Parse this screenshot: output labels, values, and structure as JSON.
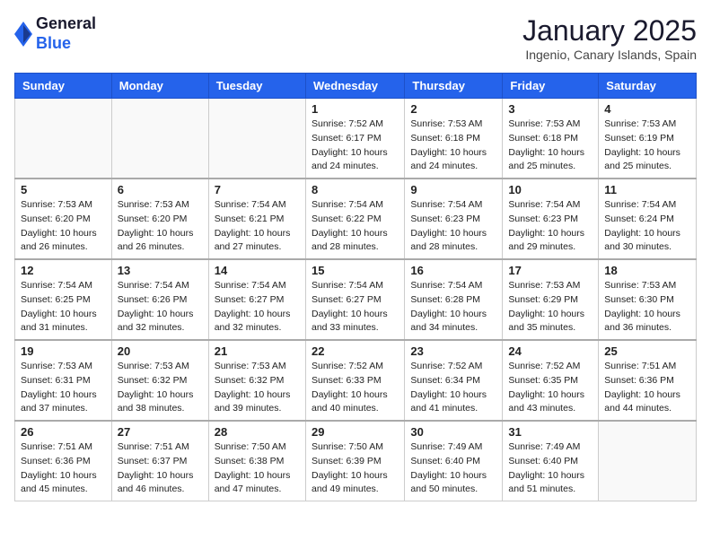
{
  "logo": {
    "general": "General",
    "blue": "Blue"
  },
  "title": "January 2025",
  "location": "Ingenio, Canary Islands, Spain",
  "days_of_week": [
    "Sunday",
    "Monday",
    "Tuesday",
    "Wednesday",
    "Thursday",
    "Friday",
    "Saturday"
  ],
  "weeks": [
    [
      {
        "day": "",
        "detail": ""
      },
      {
        "day": "",
        "detail": ""
      },
      {
        "day": "",
        "detail": ""
      },
      {
        "day": "1",
        "detail": "Sunrise: 7:52 AM\nSunset: 6:17 PM\nDaylight: 10 hours\nand 24 minutes."
      },
      {
        "day": "2",
        "detail": "Sunrise: 7:53 AM\nSunset: 6:18 PM\nDaylight: 10 hours\nand 24 minutes."
      },
      {
        "day": "3",
        "detail": "Sunrise: 7:53 AM\nSunset: 6:18 PM\nDaylight: 10 hours\nand 25 minutes."
      },
      {
        "day": "4",
        "detail": "Sunrise: 7:53 AM\nSunset: 6:19 PM\nDaylight: 10 hours\nand 25 minutes."
      }
    ],
    [
      {
        "day": "5",
        "detail": "Sunrise: 7:53 AM\nSunset: 6:20 PM\nDaylight: 10 hours\nand 26 minutes."
      },
      {
        "day": "6",
        "detail": "Sunrise: 7:53 AM\nSunset: 6:20 PM\nDaylight: 10 hours\nand 26 minutes."
      },
      {
        "day": "7",
        "detail": "Sunrise: 7:54 AM\nSunset: 6:21 PM\nDaylight: 10 hours\nand 27 minutes."
      },
      {
        "day": "8",
        "detail": "Sunrise: 7:54 AM\nSunset: 6:22 PM\nDaylight: 10 hours\nand 28 minutes."
      },
      {
        "day": "9",
        "detail": "Sunrise: 7:54 AM\nSunset: 6:23 PM\nDaylight: 10 hours\nand 28 minutes."
      },
      {
        "day": "10",
        "detail": "Sunrise: 7:54 AM\nSunset: 6:23 PM\nDaylight: 10 hours\nand 29 minutes."
      },
      {
        "day": "11",
        "detail": "Sunrise: 7:54 AM\nSunset: 6:24 PM\nDaylight: 10 hours\nand 30 minutes."
      }
    ],
    [
      {
        "day": "12",
        "detail": "Sunrise: 7:54 AM\nSunset: 6:25 PM\nDaylight: 10 hours\nand 31 minutes."
      },
      {
        "day": "13",
        "detail": "Sunrise: 7:54 AM\nSunset: 6:26 PM\nDaylight: 10 hours\nand 32 minutes."
      },
      {
        "day": "14",
        "detail": "Sunrise: 7:54 AM\nSunset: 6:27 PM\nDaylight: 10 hours\nand 32 minutes."
      },
      {
        "day": "15",
        "detail": "Sunrise: 7:54 AM\nSunset: 6:27 PM\nDaylight: 10 hours\nand 33 minutes."
      },
      {
        "day": "16",
        "detail": "Sunrise: 7:54 AM\nSunset: 6:28 PM\nDaylight: 10 hours\nand 34 minutes."
      },
      {
        "day": "17",
        "detail": "Sunrise: 7:53 AM\nSunset: 6:29 PM\nDaylight: 10 hours\nand 35 minutes."
      },
      {
        "day": "18",
        "detail": "Sunrise: 7:53 AM\nSunset: 6:30 PM\nDaylight: 10 hours\nand 36 minutes."
      }
    ],
    [
      {
        "day": "19",
        "detail": "Sunrise: 7:53 AM\nSunset: 6:31 PM\nDaylight: 10 hours\nand 37 minutes."
      },
      {
        "day": "20",
        "detail": "Sunrise: 7:53 AM\nSunset: 6:32 PM\nDaylight: 10 hours\nand 38 minutes."
      },
      {
        "day": "21",
        "detail": "Sunrise: 7:53 AM\nSunset: 6:32 PM\nDaylight: 10 hours\nand 39 minutes."
      },
      {
        "day": "22",
        "detail": "Sunrise: 7:52 AM\nSunset: 6:33 PM\nDaylight: 10 hours\nand 40 minutes."
      },
      {
        "day": "23",
        "detail": "Sunrise: 7:52 AM\nSunset: 6:34 PM\nDaylight: 10 hours\nand 41 minutes."
      },
      {
        "day": "24",
        "detail": "Sunrise: 7:52 AM\nSunset: 6:35 PM\nDaylight: 10 hours\nand 43 minutes."
      },
      {
        "day": "25",
        "detail": "Sunrise: 7:51 AM\nSunset: 6:36 PM\nDaylight: 10 hours\nand 44 minutes."
      }
    ],
    [
      {
        "day": "26",
        "detail": "Sunrise: 7:51 AM\nSunset: 6:36 PM\nDaylight: 10 hours\nand 45 minutes."
      },
      {
        "day": "27",
        "detail": "Sunrise: 7:51 AM\nSunset: 6:37 PM\nDaylight: 10 hours\nand 46 minutes."
      },
      {
        "day": "28",
        "detail": "Sunrise: 7:50 AM\nSunset: 6:38 PM\nDaylight: 10 hours\nand 47 minutes."
      },
      {
        "day": "29",
        "detail": "Sunrise: 7:50 AM\nSunset: 6:39 PM\nDaylight: 10 hours\nand 49 minutes."
      },
      {
        "day": "30",
        "detail": "Sunrise: 7:49 AM\nSunset: 6:40 PM\nDaylight: 10 hours\nand 50 minutes."
      },
      {
        "day": "31",
        "detail": "Sunrise: 7:49 AM\nSunset: 6:40 PM\nDaylight: 10 hours\nand 51 minutes."
      },
      {
        "day": "",
        "detail": ""
      }
    ]
  ]
}
